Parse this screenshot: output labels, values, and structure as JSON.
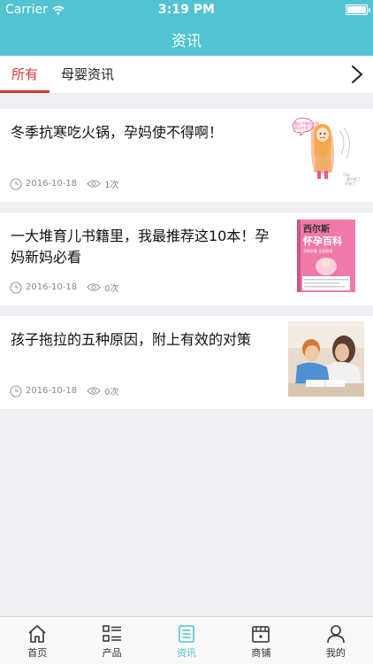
{
  "status_bar": {
    "carrier": "Carrier",
    "time": "3:19 PM"
  },
  "header": {
    "title": "资讯"
  },
  "tabs": [
    {
      "label": "所有",
      "active": true
    },
    {
      "label": "母婴资讯",
      "active": false
    }
  ],
  "articles": [
    {
      "title": "冬季抗寒吃火锅，孕妈使不得啊！",
      "date": "2016-10-18",
      "views": "1次",
      "thumb": {
        "bubble_text_1": "最近不能吃火锅",
        "bubble_text_2": "得忍住我不要吃",
        "caption_1": "可以",
        "caption_2": "我不吃了",
        "caption_3": "不说了"
      }
    },
    {
      "title": "一大堆育儿书籍里，我最推荐这10本！孕妈新妈必看",
      "date": "2016-10-18",
      "views": "0次",
      "thumb": {
        "brand": "西尔斯",
        "book_title": "怀孕百科",
        "subtitle": "孕期必备 全面解读"
      }
    },
    {
      "title": "孩子拖拉的五种原因，附上有效的对策",
      "date": "2016-10-18",
      "views": "0次",
      "thumb": {}
    }
  ],
  "bottom_nav": [
    {
      "label": "首页",
      "icon": "home-icon",
      "active": false
    },
    {
      "label": "产品",
      "icon": "list-icon",
      "active": false
    },
    {
      "label": "资讯",
      "icon": "news-icon",
      "active": true
    },
    {
      "label": "商铺",
      "icon": "shop-icon",
      "active": false
    },
    {
      "label": "我的",
      "icon": "user-icon",
      "active": false
    }
  ],
  "colors": {
    "header_bg": "#52c3d1",
    "tab_active": "#d8323a",
    "nav_active": "#52c3d1",
    "page_bg": "#efeff4"
  }
}
